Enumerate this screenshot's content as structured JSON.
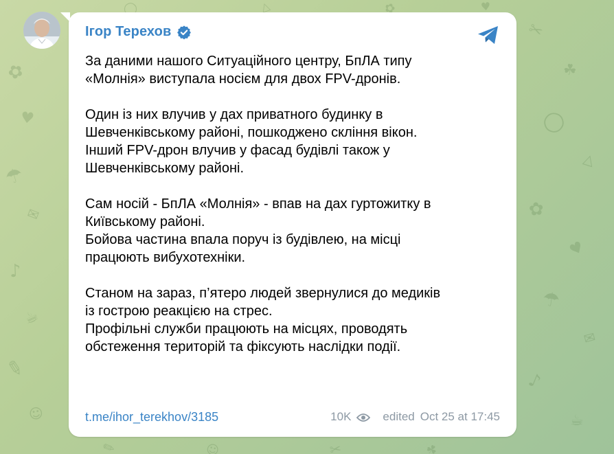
{
  "post": {
    "author": "Ігор Терехов",
    "verified_icon": "verified-badge-icon",
    "share_icon": "telegram-plane-icon",
    "paragraphs": [
      [
        "За даними нашого Ситуаційного центру, БпЛА типу",
        "«Молнія» виступала носієм для двох FPV-дронів."
      ],
      [
        "Один із них влучив у дах приватного будинку в",
        "Шевченківському районі, пошкоджено скління вікон.",
        "Інший FPV-дрон влучив у фасад будівлі також у",
        "Шевченківському районі."
      ],
      [
        "Сам носій - БпЛА «Молнія» - впав на дах гуртожитку в",
        "Київському районі.",
        "Бойова частина впала поруч із будівлею, на місці",
        "працюють вибухотехніки."
      ],
      [
        "Станом на зараз, п’ятеро людей звернулися до медиків",
        "із гострою реакцією на стрес.",
        "Профільні служби працюють на місцях, проводять",
        "обстеження територій та фіксують наслідки події."
      ]
    ],
    "link": "t.me/ihor_terekhov/3185",
    "views": "10K",
    "edited_label": "edited",
    "date": "Oct 25 at 17:45"
  },
  "colors": {
    "accent": "#3a84c6",
    "meta": "#8d99a4"
  }
}
